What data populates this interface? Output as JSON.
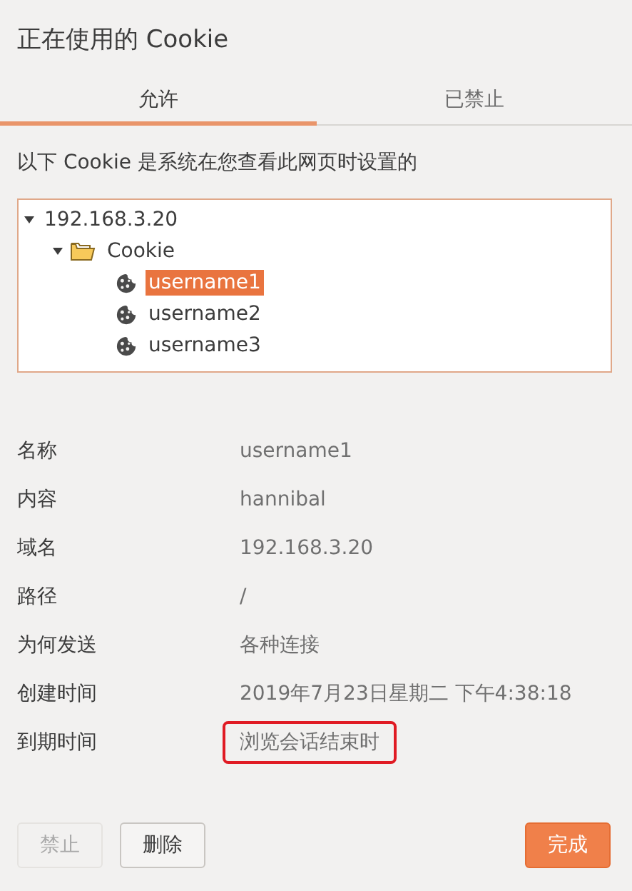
{
  "window": {
    "title": "正在使用的 Cookie"
  },
  "tabs": [
    {
      "label": "允许",
      "selected": true
    },
    {
      "label": "已禁止",
      "selected": false
    }
  ],
  "description": "以下 Cookie 是系统在您查看此网页时设置的",
  "tree": [
    {
      "label": "192.168.3.20",
      "expanded": true,
      "selected": false,
      "children": [
        {
          "label": "Cookie",
          "kind": "folder",
          "expanded": true,
          "selected": false,
          "children": [
            {
              "label": "username1",
              "kind": "cookie",
              "selected": true
            },
            {
              "label": "username2",
              "kind": "cookie",
              "selected": false
            },
            {
              "label": "username3",
              "kind": "cookie",
              "selected": false
            }
          ]
        }
      ]
    }
  ],
  "details": [
    {
      "label": "名称",
      "value": "username1",
      "highlighted": false
    },
    {
      "label": "内容",
      "value": "hannibal",
      "highlighted": false
    },
    {
      "label": "域名",
      "value": "192.168.3.20",
      "highlighted": false
    },
    {
      "label": "路径",
      "value": "/",
      "highlighted": false
    },
    {
      "label": "为何发送",
      "value": "各种连接",
      "highlighted": false
    },
    {
      "label": "创建时间",
      "value": "2019年7月23日星期二 下午4:38:18",
      "highlighted": false
    },
    {
      "label": "到期时间",
      "value": "浏览会话结束时",
      "highlighted": true
    }
  ],
  "buttons": [
    {
      "label": "禁止",
      "kind": "plain",
      "disabled": true
    },
    {
      "label": "删除",
      "kind": "plain",
      "disabled": false
    },
    {
      "label": "完成",
      "kind": "primary",
      "disabled": false
    }
  ]
}
